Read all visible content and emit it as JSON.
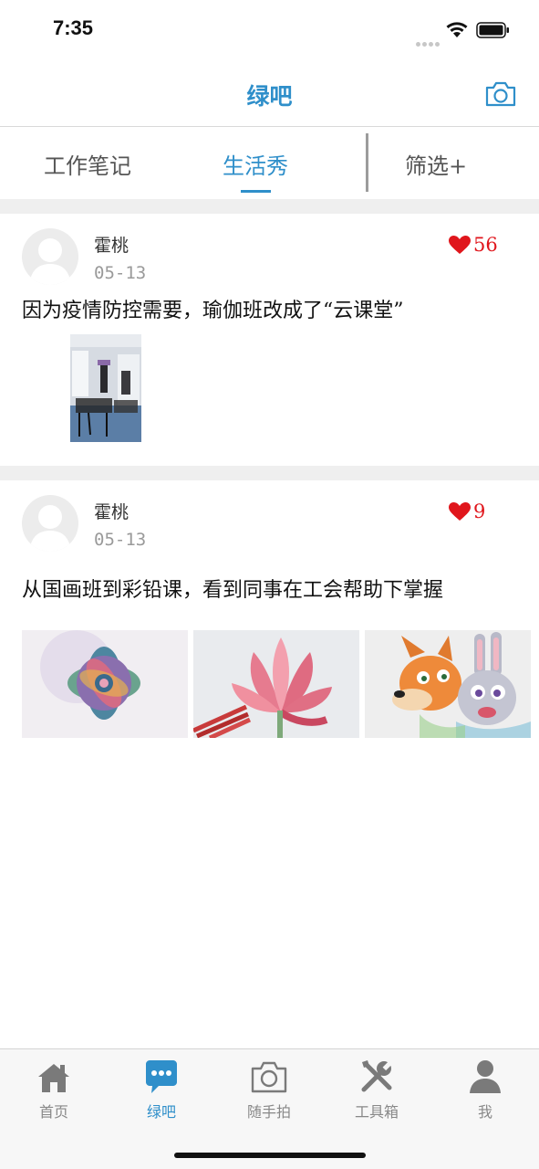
{
  "status_bar": {
    "time": "7:35"
  },
  "nav": {
    "title": "绿吧",
    "camera_icon": "camera-icon"
  },
  "tabs": [
    {
      "label": "工作笔记",
      "active": false
    },
    {
      "label": "生活秀",
      "active": true
    },
    {
      "label": "筛选+",
      "active": false
    }
  ],
  "posts": [
    {
      "author": "霍桃",
      "date": "05-13",
      "likes": "56",
      "text": "因为疫情防控需要，瑜伽班改成了“云课堂”",
      "images": [
        "yoga-classroom-photo"
      ]
    },
    {
      "author": "霍桃",
      "date": "05-13",
      "likes": "9",
      "text": "从国画班到彩铅课，看到同事在工会帮助下掌握",
      "images": [
        "succulent-watercolor-painting",
        "lotus-colored-pencil-drawing",
        "zootopia-fox-rabbit-drawing"
      ]
    }
  ],
  "tabbar": [
    {
      "label": "首页",
      "icon": "home-icon",
      "active": false
    },
    {
      "label": "绿吧",
      "icon": "chat-bubble-icon",
      "active": true
    },
    {
      "label": "随手拍",
      "icon": "camera-icon",
      "active": false
    },
    {
      "label": "工具箱",
      "icon": "tools-icon",
      "active": false
    },
    {
      "label": "我",
      "icon": "person-icon",
      "active": false
    }
  ],
  "colors": {
    "accent": "#2f8fca",
    "like_red": "#e0161c",
    "separator": "#efefef"
  }
}
